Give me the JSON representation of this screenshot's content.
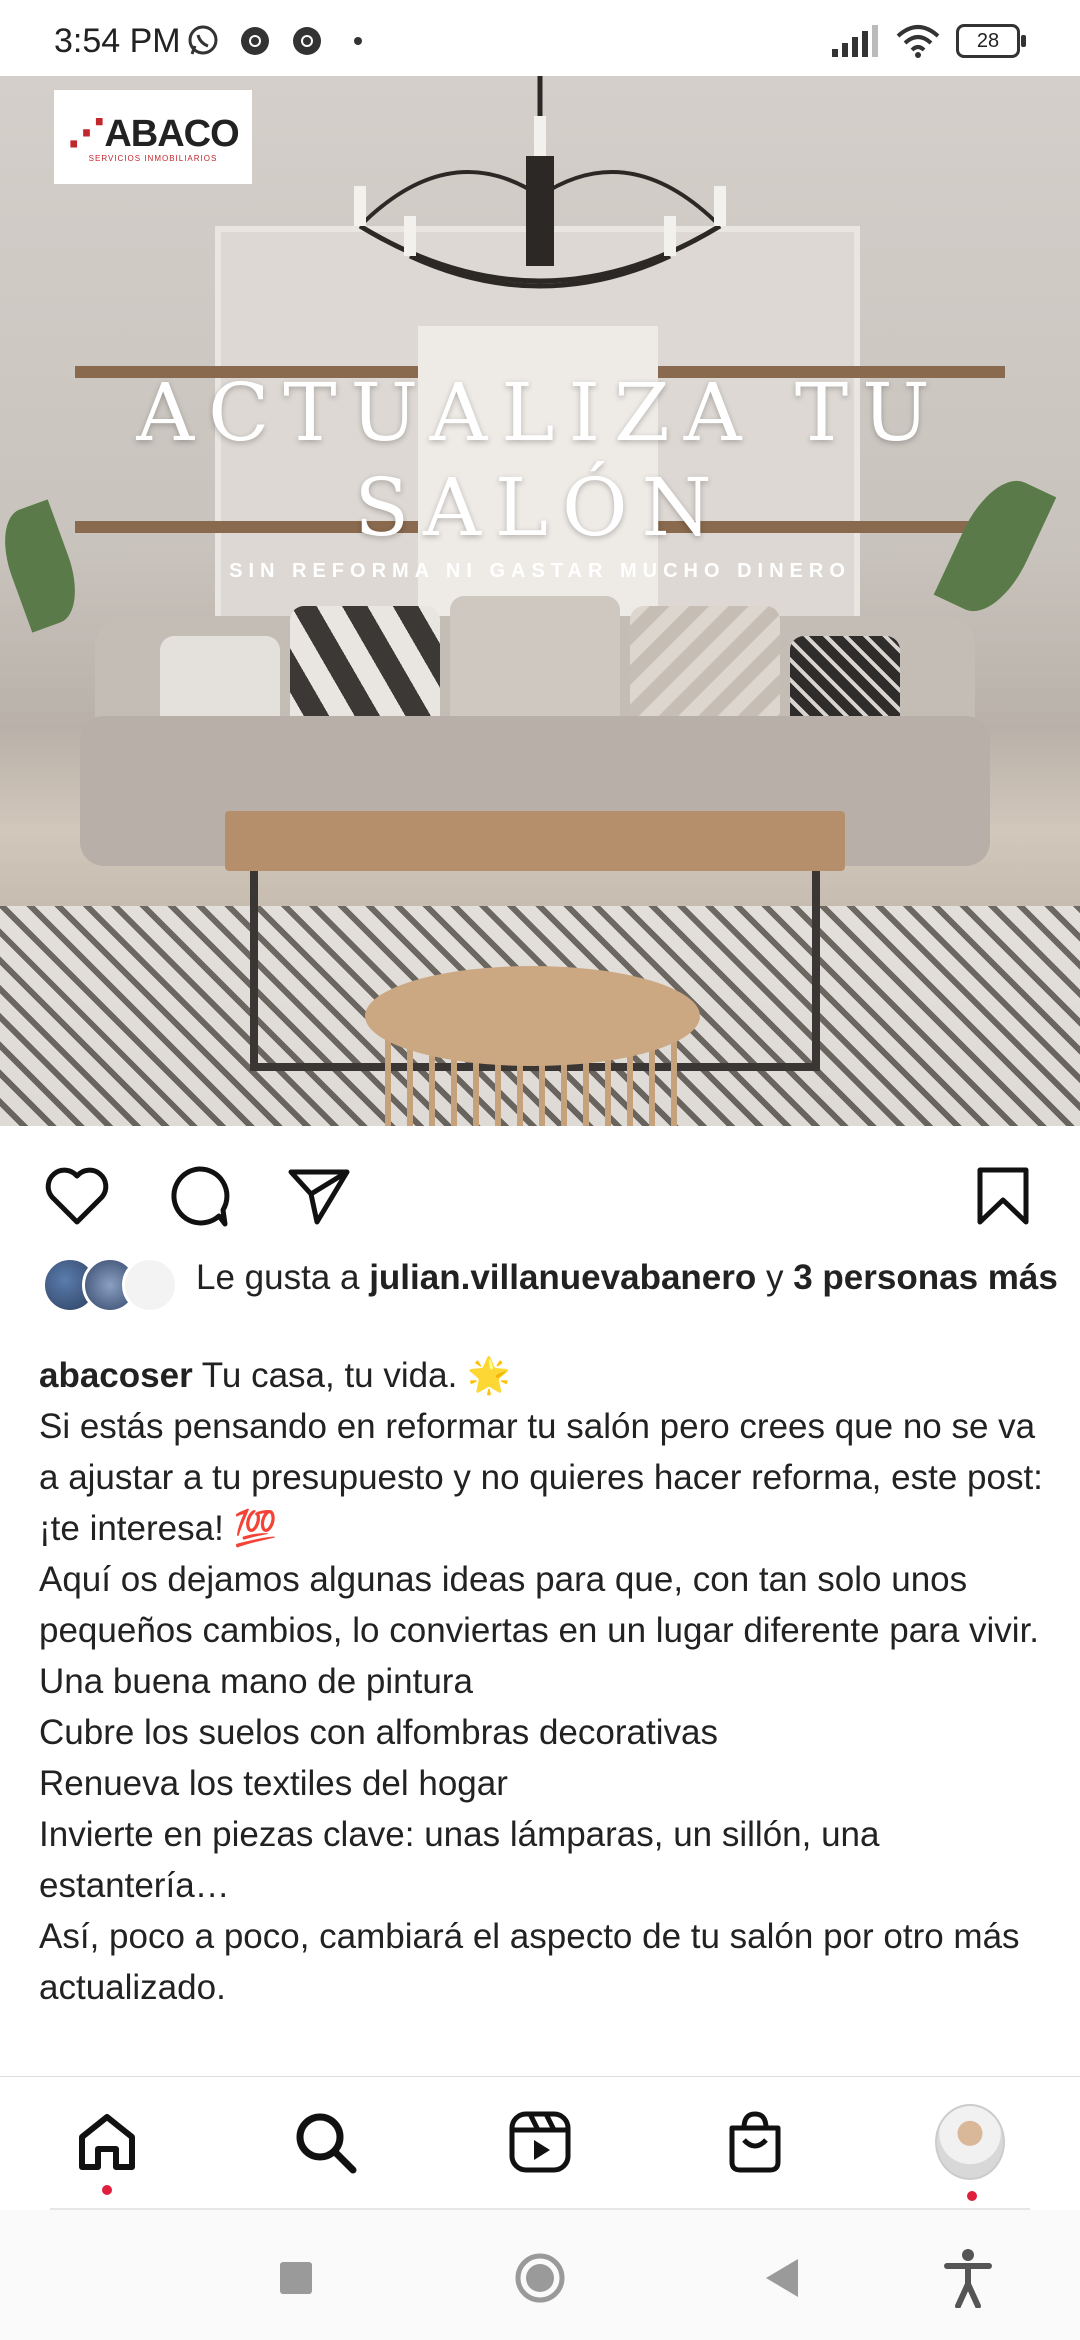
{
  "status_bar": {
    "time": "3:54 PM",
    "left_icons": [
      "whatsapp-icon",
      "chrome-icon",
      "chrome-icon",
      "dot"
    ],
    "right_icons": [
      "signal-icon",
      "wifi-icon",
      "battery-icon"
    ],
    "battery": "28"
  },
  "post": {
    "logo_text": "ABACO",
    "logo_subtext": "SERVICIOS INMOBILIARIOS",
    "headline_line1": "ACTUALIZA TU",
    "headline_line2": "SALÓN",
    "subheadline": "SIN REFORMA NI GASTAR MUCHO DINERO"
  },
  "actions": {
    "like": "heart-icon",
    "comment": "comment-icon",
    "share": "send-icon",
    "save": "bookmark-icon"
  },
  "likes": {
    "prefix": "Le gusta a ",
    "user": "julian.villanuevabanero",
    "connector": " y ",
    "others": "3 personas más"
  },
  "caption": {
    "username": "abacoser",
    "first_line": " Tu casa, tu vida. 🌟",
    "lines": [
      "Si estás pensando en reformar tu salón pero crees que no se va a ajustar a tu presupuesto y no quieres hacer reforma, este post: ¡te interesa! 💯",
      "Aquí os dejamos algunas ideas para que, con tan solo unos pequeños cambios, lo conviertas en un lugar diferente para vivir.",
      "Una buena mano de pintura",
      "Cubre los suelos con alfombras decorativas",
      "Renueva los textiles del hogar",
      "Invierte en piezas clave: unas lámparas, un sillón, una estantería…",
      "Así, poco a poco, cambiará el aspecto de tu salón por otro más actualizado."
    ]
  },
  "bottom_nav": [
    "home-icon",
    "search-icon",
    "reels-icon",
    "shop-icon",
    "profile-avatar"
  ],
  "system_nav": [
    "recents-button",
    "home-button",
    "back-button",
    "accessibility-button"
  ],
  "colors": {
    "notification_dot": "#e01f3d",
    "logo_red": "#c1272d"
  }
}
